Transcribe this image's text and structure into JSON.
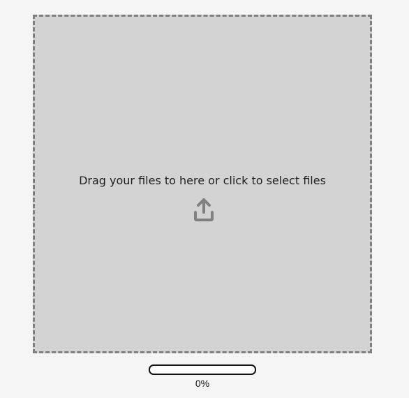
{
  "dropzone": {
    "prompt": "Drag your files to here or click to select files",
    "icon": "upload-icon"
  },
  "progress": {
    "value": 0,
    "label": "0%"
  },
  "colors": {
    "background": "#f5f5f5",
    "dropzone_fill": "#d3d3d3",
    "dropzone_border": "#808080",
    "icon": "#808080"
  }
}
